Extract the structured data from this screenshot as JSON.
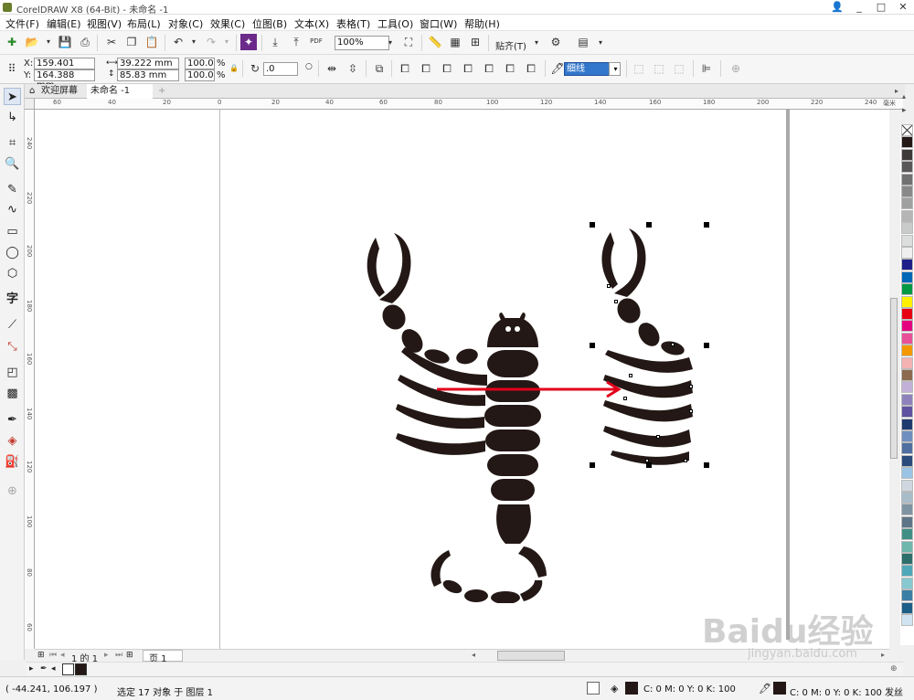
{
  "window": {
    "title": "CorelDRAW X8 (64-Bit) - 未命名 -1",
    "controls": [
      "_",
      "□",
      "✕"
    ]
  },
  "menu": [
    "文件(F)",
    "编辑(E)",
    "视图(V)",
    "布局(L)",
    "对象(C)",
    "效果(C)",
    "位图(B)",
    "文本(X)",
    "表格(T)",
    "工具(O)",
    "窗口(W)",
    "帮助(H)"
  ],
  "toolbar": {
    "zoom": "100%",
    "snap_label": "贴齐(T)",
    "pdf_label": "PDF"
  },
  "property_bar": {
    "x_label": "X:",
    "x_value": "159.401 mm",
    "y_label": "Y:",
    "y_value": "164.388 mm",
    "width_value": "39.222 mm",
    "height_value": "85.83 mm",
    "scale_x": "100.0",
    "scale_y": "100.0",
    "pct": "%",
    "rotation": ".0",
    "outline_width": "细线"
  },
  "tabs": {
    "welcome": "欢迎屏幕",
    "document": "未命名 -1",
    "add": "+"
  },
  "ruler": {
    "h_ticks": [
      "60",
      "40",
      "20",
      "0",
      "20",
      "40",
      "60",
      "80",
      "100",
      "120",
      "140",
      "160",
      "180",
      "200",
      "220",
      "240"
    ],
    "unit": "毫米",
    "v_ticks": [
      "240",
      "220",
      "200",
      "180",
      "160",
      "140",
      "120",
      "100",
      "80",
      "60"
    ]
  },
  "pagebar": {
    "page_counter": "1 的 1",
    "page_tab": "页 1"
  },
  "status": {
    "coords": "( -44.241, 106.197 )",
    "selection": "选定 17 对象 于 图层 1",
    "fill_info": "C: 0 M: 0 Y: 0 K: 100",
    "outline_info": "C: 0 M: 0 Y: 0 K: 100 发丝"
  },
  "watermark": {
    "brand": "Baidu经验",
    "url": "jingyan.baidu.com"
  },
  "palette": [
    "#ffffff",
    "#231815",
    "#3e3a39",
    "#595757",
    "#727171",
    "#898989",
    "#9fa0a0",
    "#b5b5b6",
    "#c9caca",
    "#dcdddd",
    "#efefef",
    "#1d2088",
    "#0068b7",
    "#009944",
    "#fff100",
    "#e60012",
    "#e4007f",
    "#e95098",
    "#f39800",
    "#f5b2b2",
    "#8b6a4f",
    "#c2b0d8",
    "#8f82bc",
    "#5f52a0",
    "#1f3a6e",
    "#6f8fbf",
    "#4f6fa0",
    "#2a4b7c",
    "#9ac4e4",
    "#cfd8e0",
    "#a9bcc9",
    "#7f94a3",
    "#5e7587",
    "#3f8f86",
    "#6fb6ad",
    "#2d6f6a",
    "#4fa8b8",
    "#88c8d0",
    "#3e7fa6",
    "#1c5f88",
    "#cfe4f0"
  ]
}
